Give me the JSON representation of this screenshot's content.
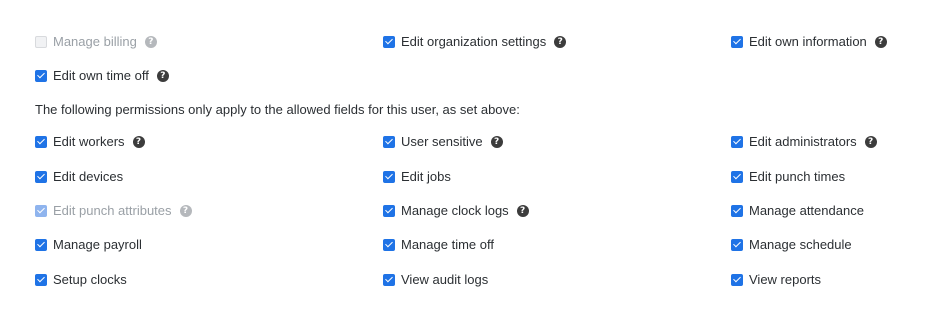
{
  "rows": [
    [
      {
        "label": "Manage billing",
        "checked": false,
        "disabled": true,
        "help": true,
        "help_icon": "question-circle-icon"
      },
      {
        "label": "Edit organization settings",
        "checked": true,
        "disabled": false,
        "help": true,
        "help_icon": "question-circle-icon"
      },
      {
        "label": "Edit own information",
        "checked": true,
        "disabled": false,
        "help": true,
        "help_icon": "question-circle-icon"
      }
    ],
    [
      {
        "label": "Edit own time off",
        "checked": true,
        "disabled": false,
        "help": true,
        "help_icon": "question-circle-icon"
      }
    ]
  ],
  "note": "The following permissions only apply to the allowed fields for this user, as set above:",
  "field_rows": [
    [
      {
        "label": "Edit workers",
        "checked": true,
        "disabled": false,
        "help": true
      },
      {
        "label": "User sensitive",
        "checked": true,
        "disabled": false,
        "help": true
      },
      {
        "label": "Edit administrators",
        "checked": true,
        "disabled": false,
        "help": true
      }
    ],
    [
      {
        "label": "Edit devices",
        "checked": true,
        "disabled": false,
        "help": false
      },
      {
        "label": "Edit jobs",
        "checked": true,
        "disabled": false,
        "help": false
      },
      {
        "label": "Edit punch times",
        "checked": true,
        "disabled": false,
        "help": false
      }
    ],
    [
      {
        "label": "Edit punch attributes",
        "checked": true,
        "disabled": true,
        "help": true
      },
      {
        "label": "Manage clock logs",
        "checked": true,
        "disabled": false,
        "help": true
      },
      {
        "label": "Manage attendance",
        "checked": true,
        "disabled": false,
        "help": false
      }
    ],
    [
      {
        "label": "Manage payroll",
        "checked": true,
        "disabled": false,
        "help": false
      },
      {
        "label": "Manage time off",
        "checked": true,
        "disabled": false,
        "help": false
      },
      {
        "label": "Manage schedule",
        "checked": true,
        "disabled": false,
        "help": false
      }
    ],
    [
      {
        "label": "Setup clocks",
        "checked": true,
        "disabled": false,
        "help": false
      },
      {
        "label": "View audit logs",
        "checked": true,
        "disabled": false,
        "help": false
      },
      {
        "label": "View reports",
        "checked": true,
        "disabled": false,
        "help": false
      }
    ]
  ],
  "colors": {
    "accent": "#1f73e6",
    "help_icon": "#3c3c3c",
    "disabled_text": "#9aa0a6"
  }
}
